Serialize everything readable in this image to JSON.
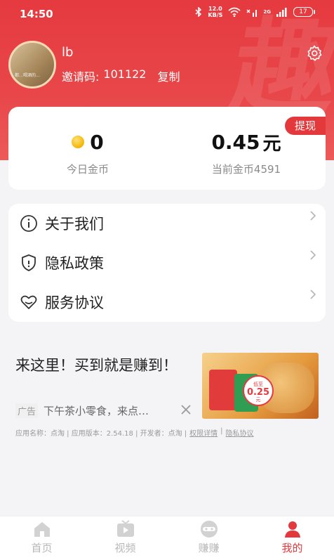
{
  "status_bar": {
    "time": "14:50",
    "net_speed_value": "12.0",
    "net_speed_unit": "KB/S",
    "battery": "17",
    "network": "2G"
  },
  "header": {
    "watermark_char": "趣",
    "avatar_caption": "都…喝酒的…",
    "username": "lb",
    "invite_label": "邀请码:",
    "invite_code": "101122",
    "copy_label": "复制"
  },
  "coins": {
    "withdraw_label": "提现",
    "today_value": "0",
    "today_label": "今日金币",
    "current_value": "0.45",
    "current_unit": "元",
    "current_label": "当前金币4591"
  },
  "menu": {
    "items": [
      {
        "label": "关于我们",
        "icon": "info-icon"
      },
      {
        "label": "隐私政策",
        "icon": "shield-icon"
      },
      {
        "label": "服务协议",
        "icon": "heart-icon"
      }
    ]
  },
  "ad": {
    "headline": "来这里！买到就是赚到！",
    "tag": "广告",
    "description": "下午茶小零食，来点…",
    "price_line1": "低至",
    "price_value": "0.25",
    "price_unit": "元",
    "meta_app": "应用名称：点淘 | 应用版本：2.54.18 | 开发者：点淘 |",
    "meta_permissions": "权限详情",
    "meta_sep": "|",
    "meta_privacy": "隐私协议"
  },
  "tabbar": {
    "tabs": [
      {
        "label": "首页",
        "icon": "home-icon",
        "active": false
      },
      {
        "label": "视频",
        "icon": "video-icon",
        "active": false
      },
      {
        "label": "赚赚",
        "icon": "earn-icon",
        "active": false
      },
      {
        "label": "我的",
        "icon": "profile-icon",
        "active": true
      }
    ]
  },
  "colors": {
    "brand_red": "#e4393c",
    "hero_gradient_top": "#e53a3f",
    "coin_gold": "#f5b400",
    "background": "#f4f4f6"
  }
}
